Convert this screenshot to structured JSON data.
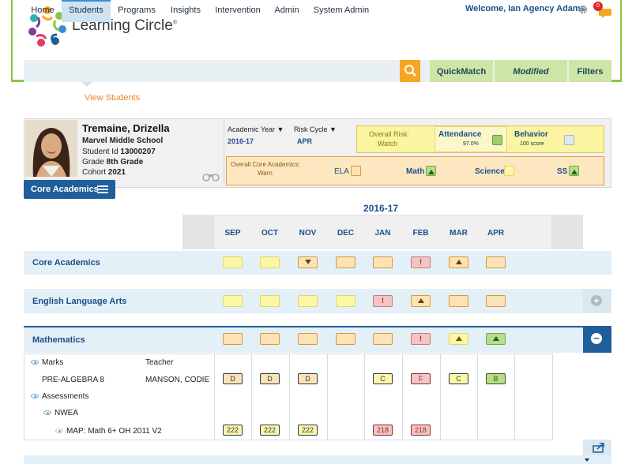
{
  "app": {
    "title": "Learning Circle",
    "registered": "®"
  },
  "header": {
    "welcome": "Welcome, Ian Agency Adams",
    "notification_count": "0"
  },
  "nav": {
    "items": [
      "Home",
      "Students",
      "Programs",
      "Insights",
      "Intervention",
      "Admin",
      "System Admin"
    ],
    "active": "Students",
    "sub_item": "View Students"
  },
  "tools": {
    "quickmatch": "QuickMatch",
    "modified": "Modified",
    "filters": "Filters"
  },
  "student": {
    "name": "Tremaine, Drizella",
    "school": "Marvel Middle School",
    "id_label": "Student Id",
    "id": "13000207",
    "grade_label": "Grade",
    "grade": "8th Grade",
    "cohort_label": "Cohort",
    "cohort": "2021"
  },
  "filters": {
    "year_label": "Academic Year ▼",
    "year": "2016-17",
    "cycle_label": "Risk Cycle ▼",
    "cycle": "APR"
  },
  "risk": {
    "overall_label": "Overall Risk:",
    "overall_value": "Watch",
    "attendance_label": "Attendance",
    "attendance_value": "97.0%",
    "behavior_label": "Behavior",
    "behavior_value": "100 score"
  },
  "core": {
    "label": "Overall Core Academics:",
    "value": "Warn",
    "ela": "ELA",
    "math": "Math",
    "science": "Science",
    "ss": "SS"
  },
  "tab": {
    "label": "Core Academics"
  },
  "grid": {
    "year": "2016-17",
    "months": [
      "SEP",
      "OCT",
      "NOV",
      "DEC",
      "JAN",
      "FEB",
      "MAR",
      "APR"
    ],
    "sections": [
      {
        "title": "Core Academics",
        "cells": [
          "y",
          "y",
          "o-dn",
          "o",
          "o",
          "r-!",
          "o-up",
          "o"
        ]
      },
      {
        "title": "English Language Arts",
        "cells": [
          "y",
          "y",
          "y",
          "y",
          "r-!",
          "o-up",
          "o",
          "o"
        ]
      },
      {
        "title": "Mathematics",
        "cells": [
          "o",
          "o",
          "o",
          "o",
          "o",
          "r-!",
          "y-up",
          "g-up"
        ]
      }
    ]
  },
  "detail": {
    "marks_label": "Marks",
    "teacher_label": "Teacher",
    "course": "PRE-ALGEBRA 8",
    "teacher": "MANSON, CODIE",
    "grades": [
      "D",
      "D",
      "D",
      "",
      "C",
      "F",
      "C",
      "B"
    ],
    "assessments_label": "Assessments",
    "nwea_label": "NWEA",
    "map_label": "MAP: Math 6+ OH 2011 V2",
    "map_scores": [
      "222",
      "222",
      "222",
      "",
      "218",
      "218",
      "",
      ""
    ]
  },
  "colors": {
    "accent": "#8dc63f",
    "brand_blue": "#1e5e9a",
    "search": "#f5a623"
  }
}
